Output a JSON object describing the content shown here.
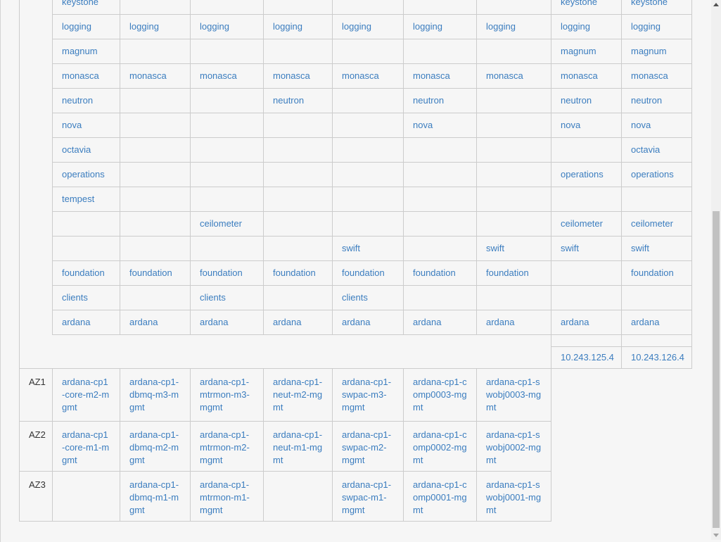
{
  "services": [
    [
      "keystone",
      "",
      "",
      "",
      "",
      "",
      "",
      "keystone",
      "keystone"
    ],
    [
      "logging",
      "logging",
      "logging",
      "logging",
      "logging",
      "logging",
      "logging",
      "logging",
      "logging"
    ],
    [
      "magnum",
      "",
      "",
      "",
      "",
      "",
      "",
      "magnum",
      "magnum"
    ],
    [
      "monasca",
      "monasca",
      "monasca",
      "monasca",
      "monasca",
      "monasca",
      "monasca",
      "monasca",
      "monasca"
    ],
    [
      "neutron",
      "",
      "",
      "neutron",
      "",
      "neutron",
      "",
      "neutron",
      "neutron"
    ],
    [
      "nova",
      "",
      "",
      "",
      "",
      "nova",
      "",
      "nova",
      "nova"
    ],
    [
      "octavia",
      "",
      "",
      "",
      "",
      "",
      "",
      "",
      "octavia"
    ],
    [
      "operations",
      "",
      "",
      "",
      "",
      "",
      "",
      "operations",
      "operations"
    ],
    [
      "tempest",
      "",
      "",
      "",
      "",
      "",
      "",
      "",
      ""
    ],
    [
      "",
      "",
      "ceilometer",
      "",
      "",
      "",
      "",
      "ceilometer",
      "ceilometer"
    ],
    [
      "",
      "",
      "",
      "",
      "swift",
      "",
      "swift",
      "swift",
      "swift"
    ],
    [
      "foundation",
      "foundation",
      "foundation",
      "foundation",
      "foundation",
      "foundation",
      "foundation",
      "",
      "foundation"
    ],
    [
      "clients",
      "",
      "clients",
      "",
      "clients",
      "",
      "",
      "",
      ""
    ],
    [
      "ardana",
      "ardana",
      "ardana",
      "ardana",
      "ardana",
      "ardana",
      "ardana",
      "ardana",
      "ardana"
    ]
  ],
  "addresses": [
    "10.243.125.4",
    "10.243.126.4"
  ],
  "zones": [
    {
      "label": "AZ1",
      "hosts": [
        "ardana-cp1-core-m2-mgmt",
        "ardana-cp1-dbmq-m3-mgmt",
        "ardana-cp1-mtrmon-m3-mgmt",
        "ardana-cp1-neut-m2-mgmt",
        "ardana-cp1-swpac-m3-mgmt",
        "ardana-cp1-comp0003-mgmt",
        "ardana-cp1-swobj0003-mgmt"
      ]
    },
    {
      "label": "AZ2",
      "hosts": [
        "ardana-cp1-core-m1-mgmt",
        "ardana-cp1-dbmq-m2-mgmt",
        "ardana-cp1-mtrmon-m2-mgmt",
        "ardana-cp1-neut-m1-mgmt",
        "ardana-cp1-swpac-m2-mgmt",
        "ardana-cp1-comp0002-mgmt",
        "ardana-cp1-swobj0002-mgmt"
      ]
    },
    {
      "label": "AZ3",
      "hosts": [
        "",
        "ardana-cp1-dbmq-m1-mgmt",
        "ardana-cp1-mtrmon-m1-mgmt",
        "",
        "ardana-cp1-swpac-m1-mgmt",
        "ardana-cp1-comp0001-mgmt",
        "ardana-cp1-swobj0001-mgmt"
      ]
    }
  ],
  "colors": {
    "link": "#3b7dbf",
    "border": "#cccccc",
    "background": "#f6f6f6"
  }
}
